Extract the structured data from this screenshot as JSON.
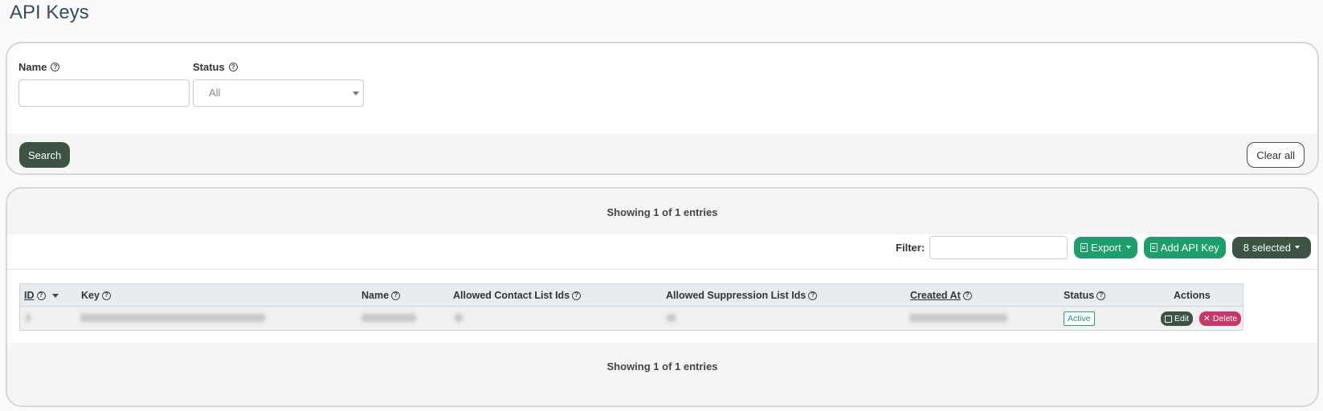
{
  "page": {
    "title": "API Keys"
  },
  "search": {
    "name_label": "Name",
    "name_value": "",
    "status_label": "Status",
    "status_value": "All",
    "search_button": "Search",
    "clear_button": "Clear all"
  },
  "results": {
    "showing_top": "Showing 1 of 1 entries",
    "showing_bottom": "Showing 1 of 1 entries",
    "filter_label": "Filter:",
    "filter_value": "",
    "export_button": "Export",
    "add_button": "Add API Key",
    "selected_button": "8 selected"
  },
  "table": {
    "columns": [
      "ID",
      "Key",
      "Name",
      "Allowed Contact List Ids",
      "Allowed Suppression List Ids",
      "Created At",
      "Status",
      "Actions"
    ],
    "rows": [
      {
        "status": "Active",
        "edit_label": "Edit",
        "delete_label": "Delete"
      }
    ]
  },
  "colors": {
    "primary_dark": "#3d5443",
    "primary_green": "#1d9f6a",
    "danger": "#c8366e"
  }
}
